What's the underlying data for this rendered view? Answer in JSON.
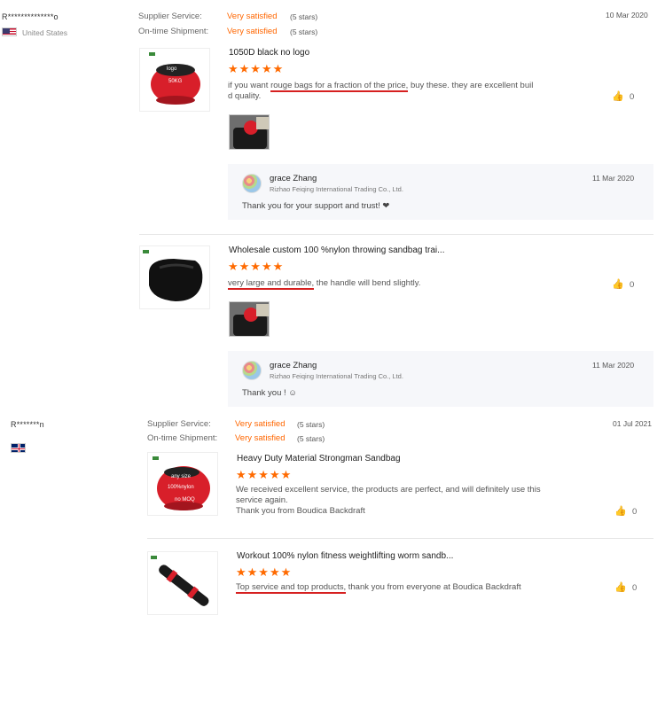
{
  "review1": {
    "reviewer": "R**************o",
    "country": "United States",
    "supplier_service_label": "Supplier Service:",
    "supplier_service_value": "Very satisfied",
    "supplier_service_stars": "(5 stars)",
    "shipment_label": "On-time Shipment:",
    "shipment_value": "Very satisfied",
    "shipment_stars": "(5 stars)",
    "date": "10 Mar 2020",
    "products": [
      {
        "title": "1050D black no logo",
        "stars": "★★★★★",
        "text_pre": "if you want ",
        "text_hl": "rouge bags for a fraction of the price,",
        "text_post": " buy these. they are excellent buil",
        "text_line2": "d quality.",
        "likes": "0",
        "thumb_label_top": "logo",
        "thumb_label_bottom": "50KG",
        "reply": {
          "name": "grace Zhang",
          "company": "Rizhao Feiqing International Trading Co., Ltd.",
          "date": "11 Mar 2020",
          "text": "Thank you for your support and trust! ❤"
        }
      },
      {
        "title": "Wholesale custom 100 %nylon throwing sandbag trai...",
        "stars": "★★★★★",
        "text_hl": "very large and durable,",
        "text_post": " the handle will bend slightly.",
        "likes": "0",
        "reply": {
          "name": "grace Zhang",
          "company": "Rizhao Feiqing International Trading Co., Ltd.",
          "date": "11 Mar 2020",
          "text": "Thank you ! ☺"
        }
      }
    ]
  },
  "review2": {
    "reviewer": "R*******n",
    "supplier_service_label": "Supplier Service:",
    "supplier_service_value": "Very satisfied",
    "supplier_service_stars": "(5 stars)",
    "shipment_label": "On-time Shipment:",
    "shipment_value": "Very satisfied",
    "shipment_stars": "(5 stars)",
    "date": "01 Jul 2021",
    "products": [
      {
        "title": "Heavy Duty Material Strongman Sandbag",
        "stars": "★★★★★",
        "text_line1": "We received excellent service, the products are perfect, and will definitely use this",
        "text_line2": "service again.",
        "text_line3": "Thank you from Boudica Backdraft",
        "likes": "0",
        "thumb_label_top": "any size",
        "thumb_label_mid": "100%nylon",
        "thumb_label_bottom": "no MOQ"
      },
      {
        "title": "Workout 100% nylon fitness weightlifting worm sandb...",
        "stars": "★★★★★",
        "text_hl": "Top service and top products,",
        "text_post": " thank you from everyone at Boudica Backdraft",
        "likes": "0"
      }
    ]
  },
  "icons": {
    "like": "thumbs-up-icon",
    "colors": {
      "accent": "#ff6600",
      "underline": "#d62020",
      "reply_bg": "#f6f7fa"
    }
  }
}
